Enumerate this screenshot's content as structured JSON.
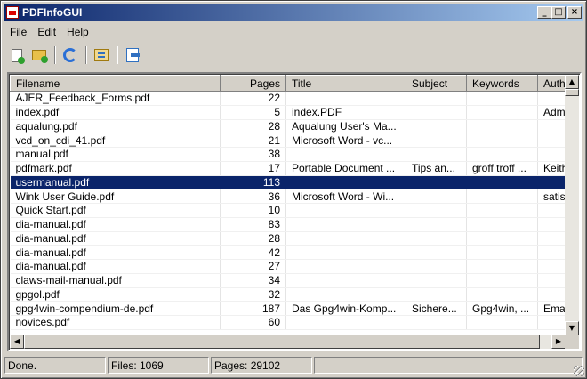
{
  "window": {
    "title": "PDFInfoGUI"
  },
  "title_buttons": {
    "minimize": "_",
    "maximize": "□",
    "close": "×"
  },
  "menu": [
    {
      "label": "File"
    },
    {
      "label": "Edit"
    },
    {
      "label": "Help"
    }
  ],
  "toolbar": [
    {
      "icon": "add-file-icon"
    },
    {
      "icon": "add-folder-icon"
    },
    {
      "icon": "refresh-icon"
    },
    {
      "icon": "properties-icon"
    },
    {
      "icon": "exit-icon"
    }
  ],
  "columns": [
    "Filename",
    "Pages",
    "Title",
    "Subject",
    "Keywords",
    "Auth"
  ],
  "rows": [
    [
      "AJER_Feedback_Forms.pdf",
      "22",
      "",
      "",
      "",
      ""
    ],
    [
      "index.pdf",
      "5",
      "index.PDF",
      "",
      "",
      "Adm"
    ],
    [
      "aqualung.pdf",
      "28",
      "Aqualung User's Ma...",
      "",
      "",
      ""
    ],
    [
      "vcd_on_cdi_41.pdf",
      "21",
      "Microsoft Word - vc...",
      "",
      "",
      ""
    ],
    [
      "manual.pdf",
      "38",
      "",
      "",
      "",
      ""
    ],
    [
      "pdfmark.pdf",
      "17",
      "Portable Document ...",
      "Tips an...",
      "groff troff ...",
      "Keith"
    ],
    [
      "usermanual.pdf",
      "113",
      "",
      "",
      "",
      ""
    ],
    [
      "Wink User Guide.pdf",
      "36",
      "Microsoft Word - Wi...",
      "",
      "",
      "satis"
    ],
    [
      "Quick Start.pdf",
      "10",
      "",
      "",
      "",
      ""
    ],
    [
      "dia-manual.pdf",
      "83",
      "",
      "",
      "",
      ""
    ],
    [
      "dia-manual.pdf",
      "28",
      "",
      "",
      "",
      ""
    ],
    [
      "dia-manual.pdf",
      "42",
      "",
      "",
      "",
      ""
    ],
    [
      "dia-manual.pdf",
      "27",
      "",
      "",
      "",
      ""
    ],
    [
      "claws-mail-manual.pdf",
      "34",
      "",
      "",
      "",
      ""
    ],
    [
      "gpgol.pdf",
      "32",
      "",
      "",
      "",
      ""
    ],
    [
      "gpg4win-compendium-de.pdf",
      "187",
      "Das Gpg4win-Komp...",
      "Sichere...",
      "Gpg4win, ...",
      "Ema"
    ],
    [
      "novices.pdf",
      "60",
      "",
      "",
      "",
      ""
    ]
  ],
  "selected_row_index": 6,
  "scroll": {
    "up": "▲",
    "down": "▼",
    "left": "◀",
    "right": "▶"
  },
  "status": {
    "state": "Done.",
    "files": "Files: 1069",
    "pages": "Pages: 29102"
  }
}
